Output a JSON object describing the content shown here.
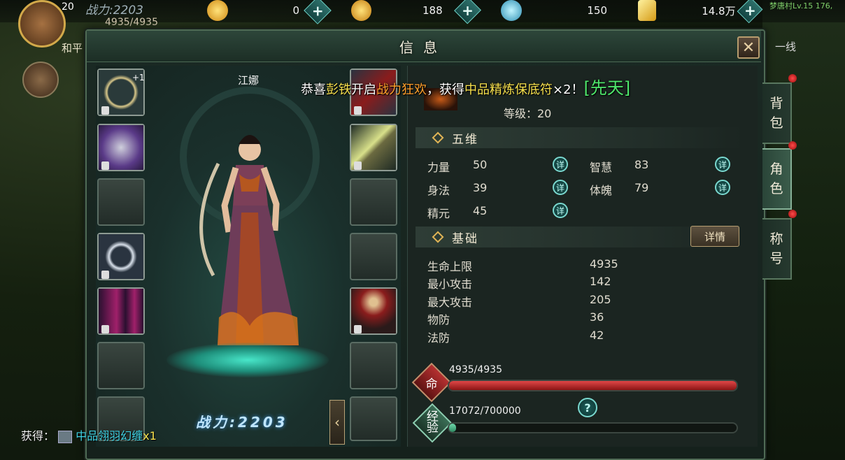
{
  "hud": {
    "player_level": "20",
    "player_power": "战力:2203",
    "player_hp": "4935/4935",
    "player_mode": "和平",
    "resources": [
      {
        "icon": "coin-icon",
        "value": "0"
      },
      {
        "icon": "bound-coin-icon",
        "value": "188"
      },
      {
        "icon": "spirit-drop-icon",
        "value": "150"
      },
      {
        "icon": "gold-ingot-icon",
        "value": "14.8万"
      }
    ],
    "location": "梦唐村Lv.15 176,",
    "channel": "一线"
  },
  "panel": {
    "title": "信息",
    "close_icon": "close-icon"
  },
  "announcement": {
    "prefix": "恭喜",
    "player": "彭铁",
    "mid1": "开启",
    "event": "战力狂欢",
    "mid2": "，获得",
    "item": "中品精炼保底符",
    "suffix": "×2！",
    "tag": "[先天]"
  },
  "character": {
    "name": "江娜",
    "power_label": "战力:2203",
    "left_slots": [
      {
        "name": "halo-slot",
        "icon": "halo-icon",
        "filled": true,
        "locked": true,
        "badge": "+1"
      },
      {
        "name": "shoulder-armor-slot",
        "icon": "shoulder-armor-icon",
        "filled": true,
        "locked": true
      },
      {
        "name": "glove-slot",
        "icon": "glove-icon",
        "filled": false,
        "locked": false
      },
      {
        "name": "ring-slot",
        "icon": "ring-icon",
        "filled": true,
        "locked": true
      },
      {
        "name": "leg-armor-slot",
        "icon": "leg-armor-icon",
        "filled": true,
        "locked": true
      },
      {
        "name": "bracelet-slot",
        "icon": "bracelet-icon",
        "filled": false,
        "locked": false
      },
      {
        "name": "left-bottom-slot",
        "icon": "empty-icon",
        "filled": false,
        "locked": false
      }
    ],
    "right_slots": [
      {
        "name": "weapon-slot",
        "icon": "weapon-icon",
        "filled": true,
        "locked": true
      },
      {
        "name": "bracer-slot",
        "icon": "bracer-icon",
        "filled": true,
        "locked": true
      },
      {
        "name": "necklace-slot",
        "icon": "necklace-icon",
        "filled": false,
        "locked": false
      },
      {
        "name": "belt-slot",
        "icon": "belt-icon",
        "filled": false,
        "locked": false
      },
      {
        "name": "robe-slot",
        "icon": "robe-icon",
        "filled": true,
        "locked": true
      },
      {
        "name": "bangle-slot",
        "icon": "bangle-icon",
        "filled": false,
        "locked": false
      },
      {
        "name": "talisman-slot",
        "icon": "talisman-icon",
        "filled": false,
        "locked": false
      }
    ]
  },
  "info": {
    "level_label": "等级：20",
    "five_dim_title": "五维",
    "five_dim": [
      {
        "label": "力量",
        "value": "50",
        "btn": "详"
      },
      {
        "label": "智慧",
        "value": "83",
        "btn": "详"
      },
      {
        "label": "身法",
        "value": "39",
        "btn": "详"
      },
      {
        "label": "体魄",
        "value": "79",
        "btn": "详"
      },
      {
        "label": "精元",
        "value": "45",
        "btn": "详"
      }
    ],
    "basic_title": "基础",
    "detail_button": "详情",
    "basic": [
      {
        "label": "生命上限",
        "value": "4935"
      },
      {
        "label": "最小攻击",
        "value": "142"
      },
      {
        "label": "最大攻击",
        "value": "205"
      },
      {
        "label": "物防",
        "value": "36"
      },
      {
        "label": "法防",
        "value": "42"
      }
    ],
    "hp_badge": "命",
    "hp_text": "4935/4935",
    "hp_fraction": 1.0,
    "exp_badge_line1": "经",
    "exp_badge_line2": "验",
    "exp_text": "17072/700000",
    "exp_fraction": 0.024,
    "help_label": "?"
  },
  "side_tabs": [
    {
      "line1": "背",
      "line2": "包",
      "active": false
    },
    {
      "line1": "角",
      "line2": "色",
      "active": true
    },
    {
      "line1": "称",
      "line2": "号",
      "active": false
    }
  ],
  "gain": {
    "prefix": "获得：",
    "item": "中品翎羽幻缠",
    "count": "x1"
  },
  "colors": {
    "accent_teal": "#6fd6cb",
    "hp_red": "#d23a3a",
    "exp_green": "#5cc89a",
    "gold": "#f6e04d"
  }
}
